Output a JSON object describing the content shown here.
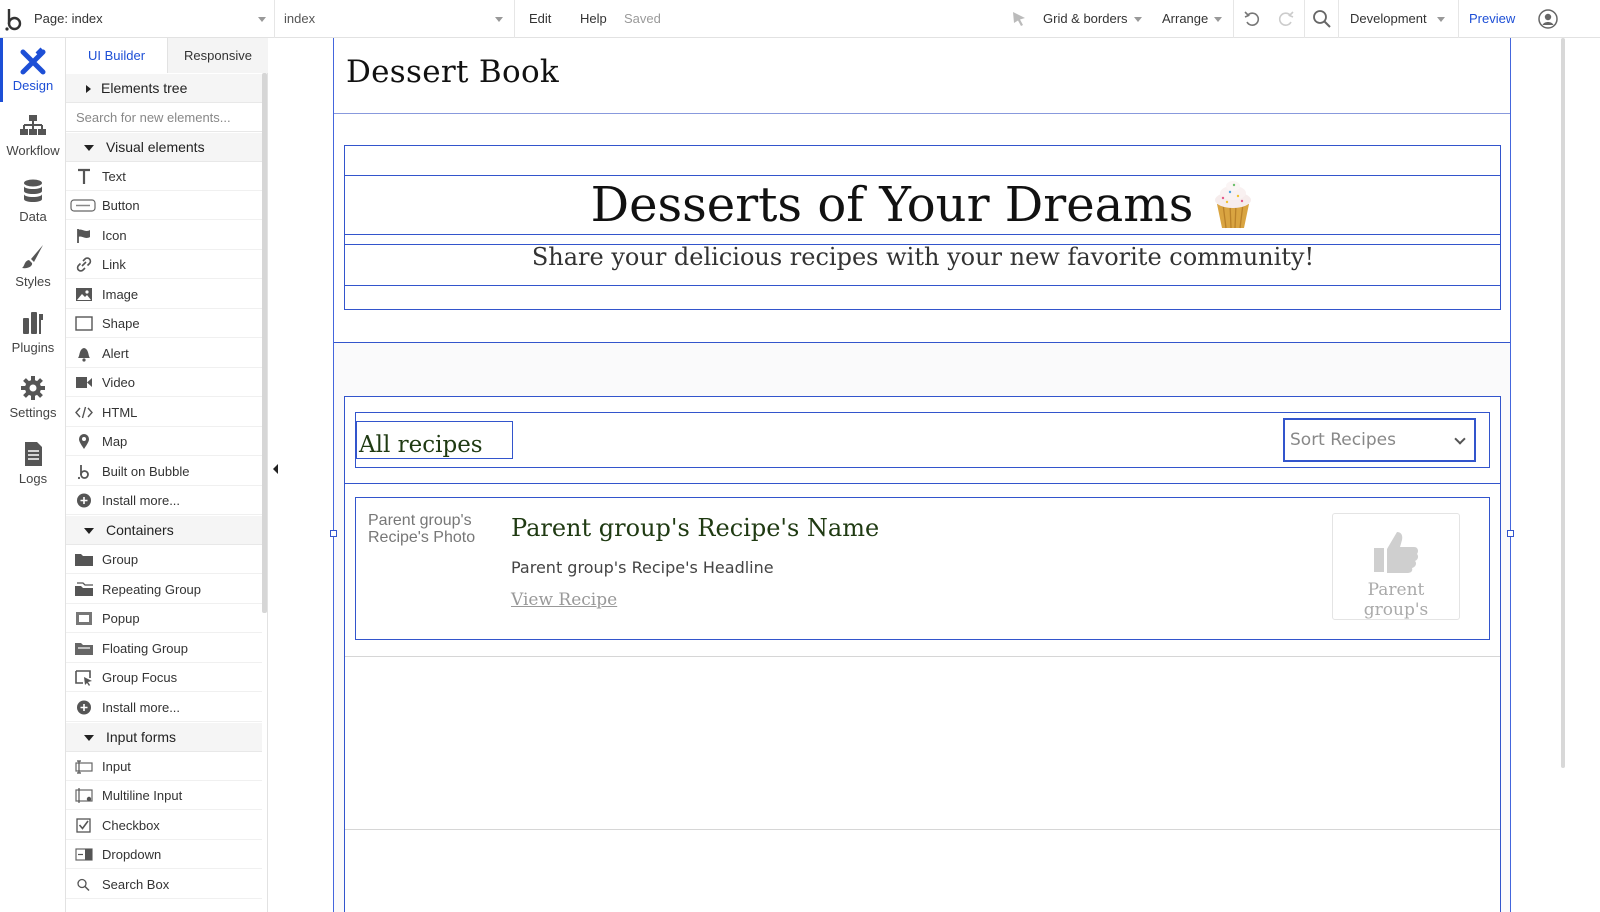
{
  "topbar": {
    "page_label": "Page: index",
    "element_select": "index",
    "edit": "Edit",
    "help": "Help",
    "saved": "Saved",
    "grid": "Grid & borders",
    "arrange": "Arrange",
    "version": "Development",
    "preview": "Preview"
  },
  "iconbar": {
    "items": [
      {
        "label": "Design",
        "icon": "design-icon"
      },
      {
        "label": "Workflow",
        "icon": "workflow-icon"
      },
      {
        "label": "Data",
        "icon": "database-icon"
      },
      {
        "label": "Styles",
        "icon": "brush-icon"
      },
      {
        "label": "Plugins",
        "icon": "plugin-icon"
      },
      {
        "label": "Settings",
        "icon": "gear-icon"
      },
      {
        "label": "Logs",
        "icon": "document-icon"
      }
    ]
  },
  "panel": {
    "tabs": [
      "UI Builder",
      "Responsive"
    ],
    "elements_tree": "Elements tree",
    "search_placeholder": "Search for new elements...",
    "sections": {
      "visual": "Visual elements",
      "containers": "Containers",
      "inputs": "Input forms"
    },
    "visual_items": [
      "Text",
      "Button",
      "Icon",
      "Link",
      "Image",
      "Shape",
      "Alert",
      "Video",
      "HTML",
      "Map",
      "Built on Bubble",
      "Install more..."
    ],
    "container_items": [
      "Group",
      "Repeating Group",
      "Popup",
      "Floating Group",
      "Group Focus",
      "Install more..."
    ],
    "input_items": [
      "Input",
      "Multiline Input",
      "Checkbox",
      "Dropdown",
      "Search Box"
    ]
  },
  "canvas": {
    "site_title": "Dessert Book",
    "hero_title": "Desserts of Your Dreams",
    "hero_subtitle": "Share your delicious recipes with your new favorite community!",
    "all_recipes": "All recipes",
    "sort_placeholder": "Sort Recipes",
    "card": {
      "photo_label": "Parent group's Recipe's Photo",
      "name": "Parent group's Recipe's Name",
      "headline": "Parent group's Recipe's Headline",
      "link": "View Recipe",
      "like_label": "Parent group's"
    }
  },
  "colors": {
    "accent": "#1d4fd6",
    "border_select": "#3355cc",
    "title_green": "#1f3a12"
  }
}
